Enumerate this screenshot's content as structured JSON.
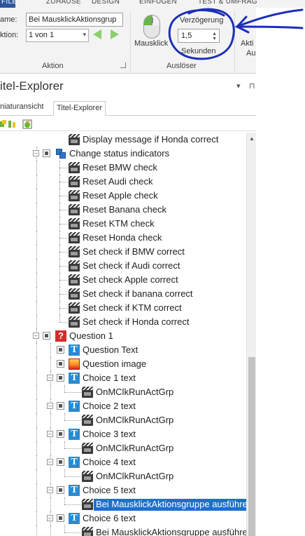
{
  "ribbon": {
    "tabs": [
      "FILE",
      "ZUHAUSE",
      "DESIGN",
      "EINFÜGEN",
      "TEST & UMFRAG"
    ],
    "name_label": "ame:",
    "name_value": "Bei MausklickAktionsgrup",
    "action_label": "ktion:",
    "action_value": "1 von 1",
    "group_aktion": "Aktion",
    "mouse_label": "Mausklick",
    "delay_label": "Verzögerung",
    "delay_value": "1,5",
    "delay_unit": "Sekunden",
    "group_ausloeser": "Auslöser",
    "cut_label_1": "Akti",
    "cut_label_2": "Au"
  },
  "panel": {
    "title": "itel-Explorer",
    "pin": "▾  ⊓",
    "subtab_thumbnails": "niaturansicht",
    "subtab_explorer": "Titel-Explorer"
  },
  "tree": [
    {
      "label": "Display message if Honda correct"
    },
    {
      "label": "Change status indicators"
    },
    {
      "label": "Reset BMW check"
    },
    {
      "label": "Reset Audi check"
    },
    {
      "label": "Reset Apple check"
    },
    {
      "label": "Reset Banana check"
    },
    {
      "label": "Reset KTM check"
    },
    {
      "label": "Reset Honda check"
    },
    {
      "label": "Set check if BMW correct"
    },
    {
      "label": "Set check if Audi correct"
    },
    {
      "label": "Set check Apple correct"
    },
    {
      "label": "Set check if banana correct"
    },
    {
      "label": "Set check if KTM correct"
    },
    {
      "label": "Set check if Honda correct"
    },
    {
      "label": "Question 1"
    },
    {
      "label": "Question Text"
    },
    {
      "label": "Question image"
    },
    {
      "label": "Choice 1 text"
    },
    {
      "label": "OnMClkRunActGrp"
    },
    {
      "label": "Choice 2 text"
    },
    {
      "label": "OnMClkRunActGrp"
    },
    {
      "label": "Choice 3 text"
    },
    {
      "label": "OnMClkRunActGrp"
    },
    {
      "label": "Choice 4 text"
    },
    {
      "label": "OnMClkRunActGrp"
    },
    {
      "label": "Choice 5 text"
    },
    {
      "label": "Bei MausklickAktionsgruppe ausführen"
    },
    {
      "label": "Choice 6 text"
    },
    {
      "label": "Bei MausklickAktionsgruppe ausführen"
    }
  ],
  "colors": {
    "file_tab": "#2b579a",
    "selection": "#1e6fd0",
    "annotation": "#1b2fb8",
    "nav_arrows": "#8bd06b"
  }
}
